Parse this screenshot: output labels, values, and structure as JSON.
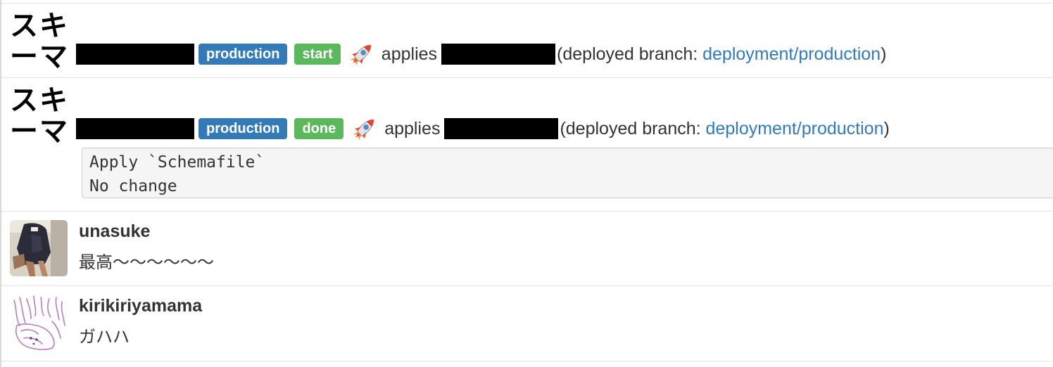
{
  "bot": {
    "avatar_line1": "スキ",
    "avatar_line2": "ーマ"
  },
  "events": [
    {
      "environment": "production",
      "status": "start",
      "action": "applies",
      "deployed_branch_prefix": "(deployed branch: ",
      "branch": "deployment/production",
      "deployed_branch_suffix": ")",
      "colors": {
        "environment": "#337ab7",
        "status": "#5cb85c"
      }
    },
    {
      "environment": "production",
      "status": "done",
      "action": "applies",
      "deployed_branch_prefix": "(deployed branch: ",
      "branch": "deployment/production",
      "deployed_branch_suffix": ")",
      "output": [
        "Apply `Schemafile`",
        "No change"
      ],
      "colors": {
        "environment": "#337ab7",
        "status": "#5cb85c"
      }
    }
  ],
  "comments": [
    {
      "user": "unasuke",
      "text": "最高〜〜〜〜〜〜"
    },
    {
      "user": "kirikiriyamama",
      "text": "ガハハ"
    }
  ],
  "icons": {
    "deploy": "rocket-icon",
    "avatar1": "user-photo-avatar",
    "avatar2": "sketch-drawing-avatar"
  },
  "colors": {
    "link": "#337ab7",
    "badge_env": "#337ab7",
    "badge_status": "#5cb85c",
    "redacted": "#000000"
  }
}
